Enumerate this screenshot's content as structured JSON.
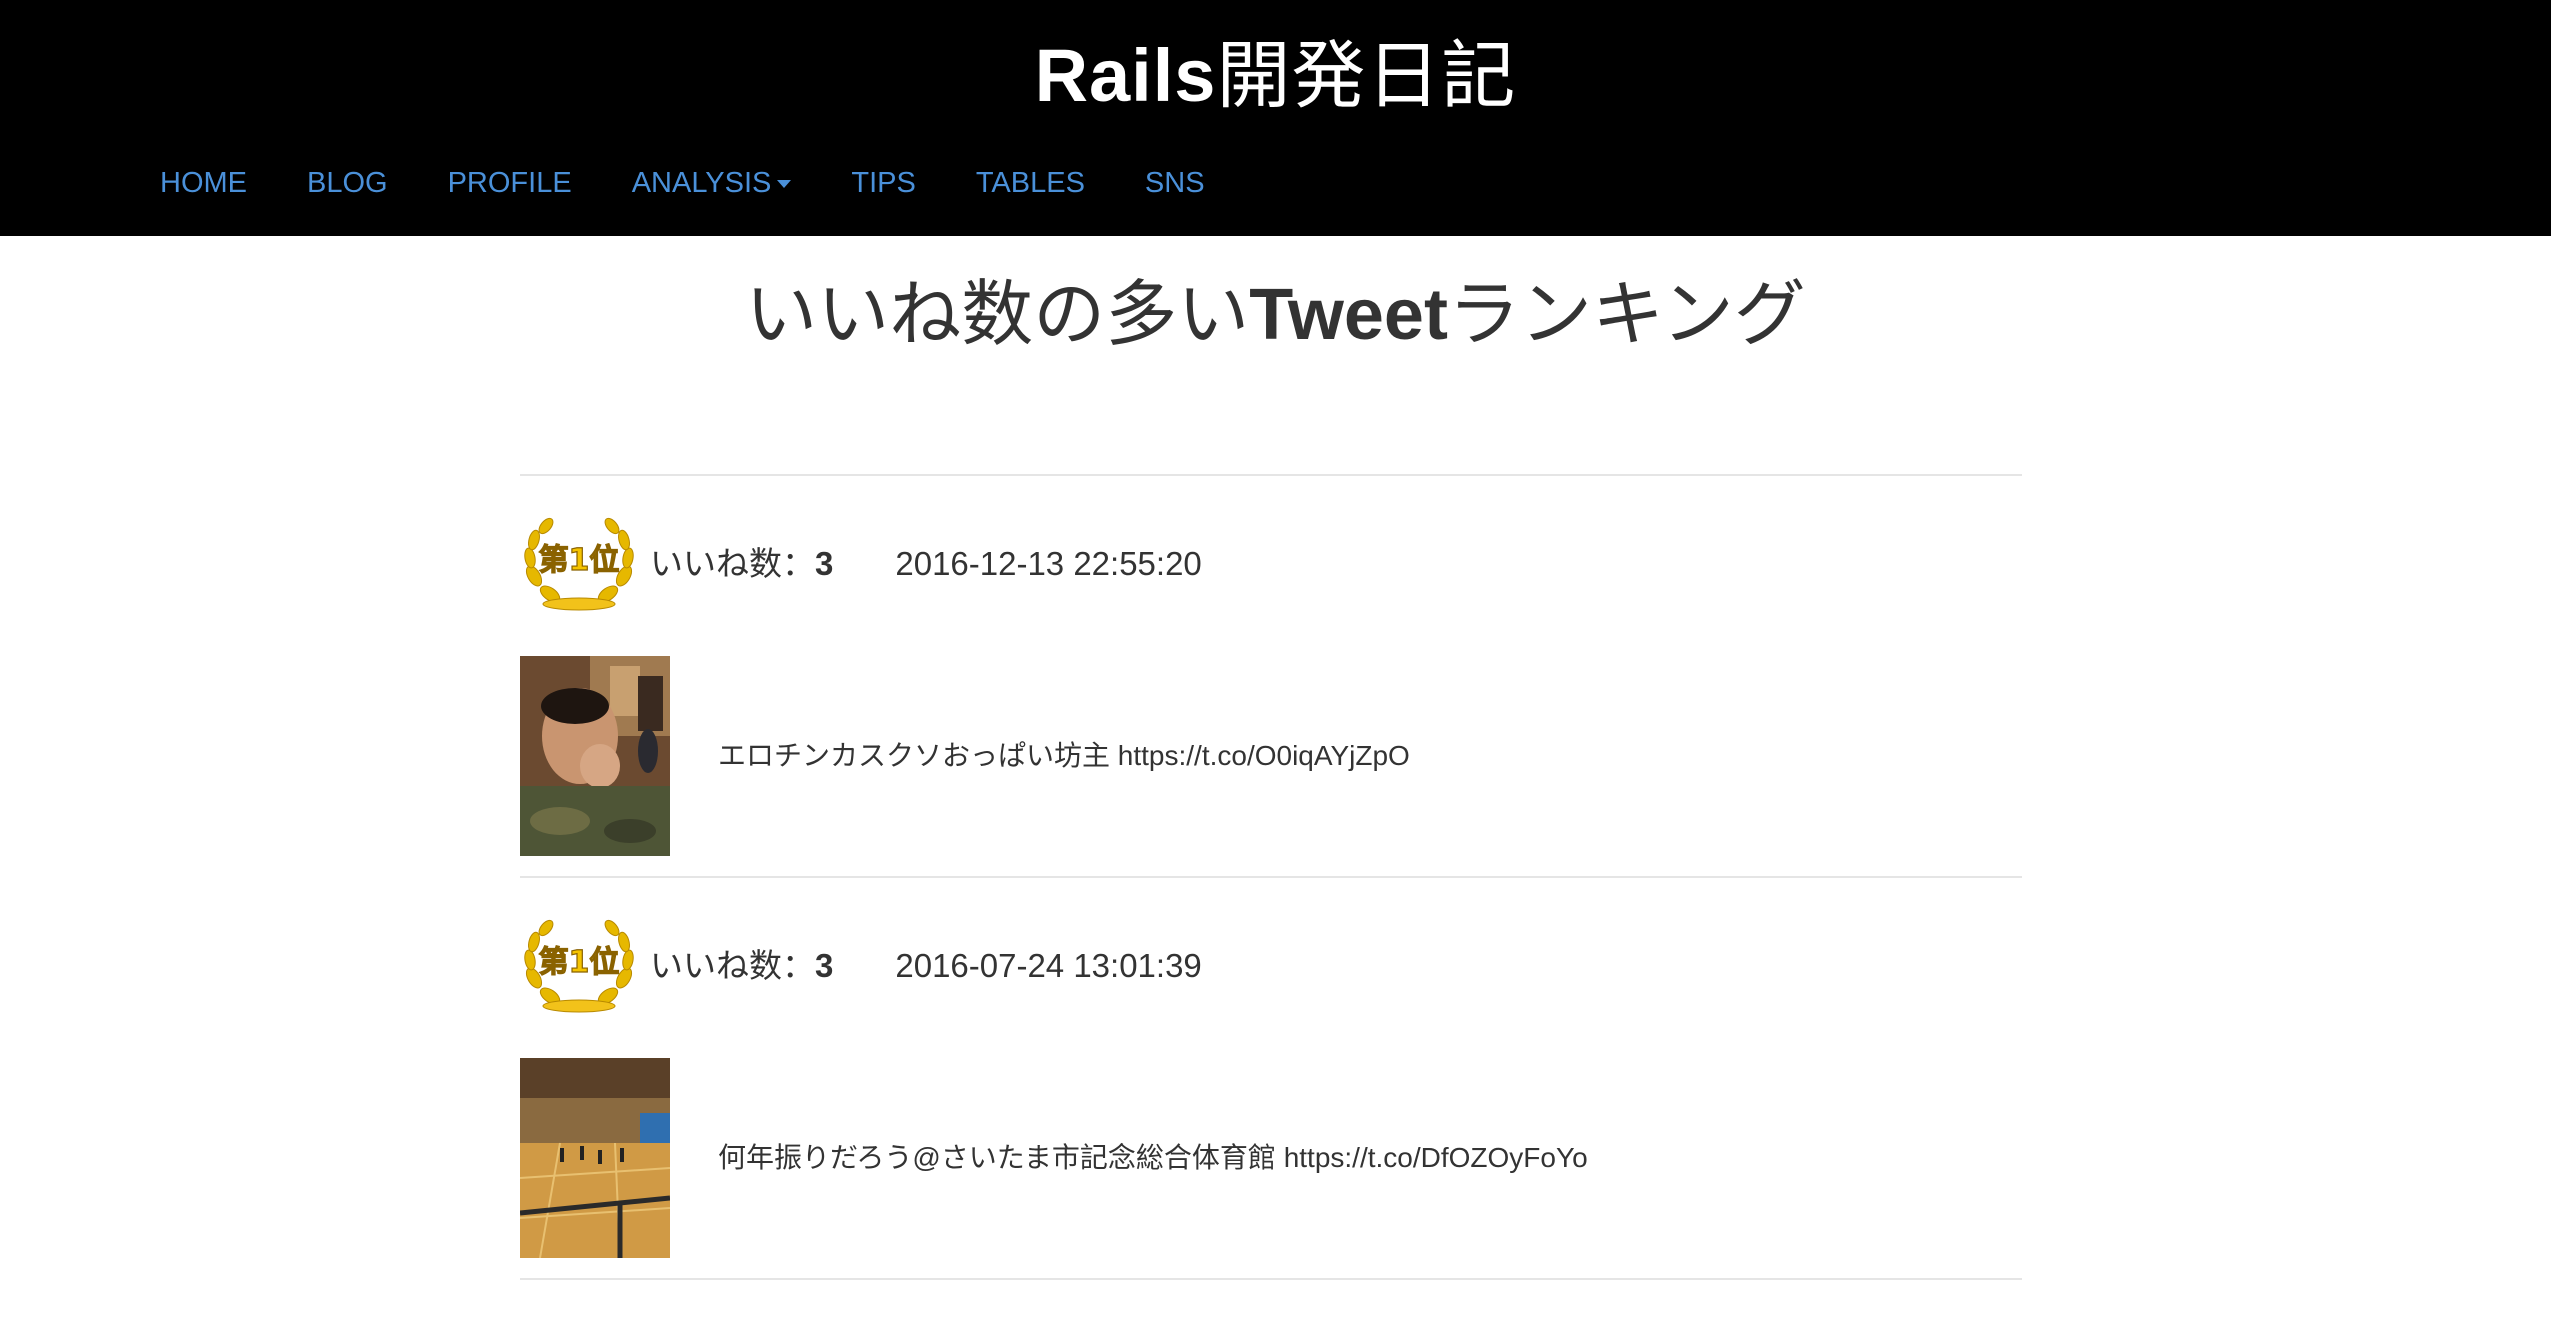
{
  "header": {
    "title_latin": "Rails",
    "title_jp": "開発日記",
    "nav": [
      {
        "label": "HOME"
      },
      {
        "label": "BLOG"
      },
      {
        "label": "PROFILE"
      },
      {
        "label": "ANALYSIS"
      },
      {
        "label": "TIPS"
      },
      {
        "label": "TABLES"
      },
      {
        "label": "SNS"
      }
    ]
  },
  "main": {
    "heading_prefix": "いいね数の多い",
    "heading_bold": "Tweet",
    "heading_suffix": "ランキング",
    "likes_label": "いいね数：",
    "badge_text": "第1位",
    "tweets": [
      {
        "rank": 1,
        "likes": "3",
        "date": "2016-12-13 22:55:20",
        "text": "エロチンカスクソおっぱい坊主 ",
        "link": "https://t.co/O0iqAYjZpO"
      },
      {
        "rank": 1,
        "likes": "3",
        "date": "2016-07-24 13:01:39",
        "text": "何年振りだろう@さいたま市記念総合体育館 ",
        "link": "https://t.co/DfOZOyFoYo"
      }
    ]
  },
  "colors": {
    "header_bg": "#000000",
    "nav_link": "#4a90d9",
    "text": "#333333",
    "divider": "#e5e5e5",
    "badge_gold": "#f2c21a"
  }
}
